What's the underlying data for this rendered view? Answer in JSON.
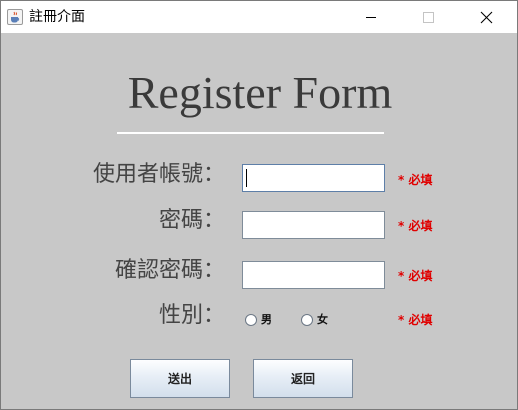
{
  "window": {
    "title": "註冊介面"
  },
  "form": {
    "title": "Register Form",
    "fields": {
      "username": {
        "label": "使用者帳號：",
        "value": "",
        "required": "* 必填"
      },
      "password": {
        "label": "密碼：",
        "value": "",
        "required": "* 必填"
      },
      "confirm_password": {
        "label": "確認密碼：",
        "value": "",
        "required": "* 必填"
      },
      "gender": {
        "label": "性別：",
        "options": [
          "男",
          "女"
        ],
        "required": "* 必填"
      }
    },
    "buttons": {
      "submit": "送出",
      "back": "返回"
    }
  },
  "colors": {
    "panel_background": "#c8c8c8",
    "required_text": "#e00000",
    "title_text": "#3a3a3a"
  },
  "icons": {
    "app": "java-cup-icon",
    "minimize": "minimize-icon",
    "maximize": "maximize-icon",
    "close": "close-icon"
  }
}
